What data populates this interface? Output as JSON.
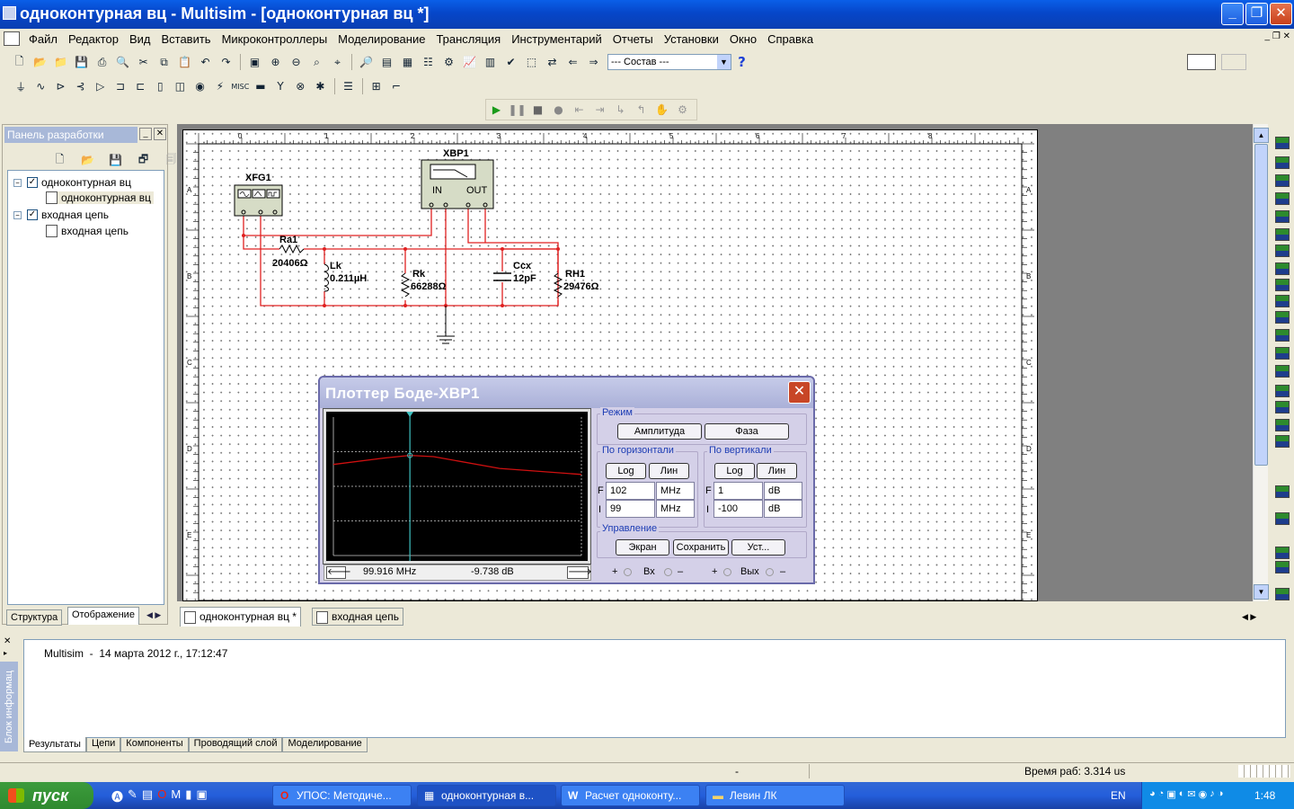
{
  "window": {
    "title": "одноконтурная вц - Multisim - [одноконтурная вц *]",
    "min": "_",
    "max": "❐",
    "close": "✕"
  },
  "menu": [
    "Файл",
    "Редактор",
    "Вид",
    "Вставить",
    "Микроконтроллеры",
    "Моделирование",
    "Трансляция",
    "Инструментарий",
    "Отчеты",
    "Установки",
    "Окно",
    "Справка"
  ],
  "toolbar": {
    "combo": "--- Состав ---",
    "help": "?"
  },
  "design_panel": {
    "title": "Панель разработки",
    "tree": [
      {
        "label": "одноконтурная вц",
        "level": 0
      },
      {
        "label": "одноконтурная вц",
        "level": 1
      },
      {
        "label": "входная цепь",
        "level": 0
      },
      {
        "label": "входная цепь",
        "level": 1
      }
    ],
    "tabs": [
      "Структура",
      "Отображение"
    ]
  },
  "schematic": {
    "ruler_top": [
      "0",
      "1",
      "2",
      "3",
      "4",
      "5",
      "6",
      "7",
      "8"
    ],
    "ruler_left": [
      "A",
      "B",
      "C",
      "D",
      "E"
    ],
    "components": {
      "xfg": {
        "ref": "XFG1"
      },
      "xbp": {
        "ref": "XBP1",
        "in": "IN",
        "out": "OUT"
      },
      "ra": {
        "ref": "Ra1",
        "value": "20406Ω"
      },
      "lk": {
        "ref": "Lk",
        "value": "0.211µH"
      },
      "rk": {
        "ref": "Rk",
        "value": "66288Ω"
      },
      "ccx": {
        "ref": "Ccx",
        "value": "12pF"
      },
      "rh": {
        "ref": "RH1",
        "value": "29476Ω"
      }
    }
  },
  "bode": {
    "title": "Плоттер Боде-XBP1",
    "mode_label": "Режим",
    "amplitude": "Амплитуда",
    "phase": "Фаза",
    "horizontal_label": "По горизонтали",
    "vertical_label": "По вертикали",
    "log": "Log",
    "lin": "Лин",
    "h_final": "102",
    "h_final_unit": "MHz",
    "h_initial": "99",
    "h_initial_unit": "MHz",
    "v_final": "1",
    "v_final_unit": "dB",
    "v_initial": "-100",
    "v_initial_unit": "dB",
    "f_label": "F",
    "i_label": "I",
    "control_label": "Управление",
    "screen": "Экран",
    "save": "Сохранить",
    "setup": "Уст...",
    "readout_freq": "99.916 MHz",
    "readout_db": "-9.738 dB",
    "in_label": "Вх",
    "out_label": "Вых",
    "plus": "+",
    "minus": "–",
    "trace_color": "#d01010",
    "cursor_color": "#40c0c0",
    "curve": {
      "freq_mhz": [
        99,
        99.6,
        99.916,
        100.2,
        101,
        102
      ],
      "db": [
        -12.3,
        -10.5,
        -9.738,
        -10.1,
        -13.4,
        -15.1
      ]
    }
  },
  "doc_tabs": [
    {
      "label": "одноконтурная вц *",
      "active": true
    },
    {
      "label": "входная цепь",
      "active": false
    }
  ],
  "info": {
    "vertical_label": "Блок информац",
    "log": "Multisim  -  14 марта 2012 г., 17:12:47",
    "tabs": [
      "Результаты",
      "Цепи",
      "Компоненты",
      "Проводящий слой",
      "Моделирование"
    ]
  },
  "status": {
    "dash": "-",
    "runtime": "Время раб: 3.314 us"
  },
  "taskbar": {
    "start": "пуск",
    "tasks": [
      {
        "label": "УПОС: Методиче...",
        "active": false
      },
      {
        "label": "одноконтурная в...",
        "active": true
      },
      {
        "label": "Расчет одноконту...",
        "active": false
      },
      {
        "label": "Левин ЛК",
        "active": false
      }
    ],
    "lang": "EN",
    "clock": "1:48"
  }
}
